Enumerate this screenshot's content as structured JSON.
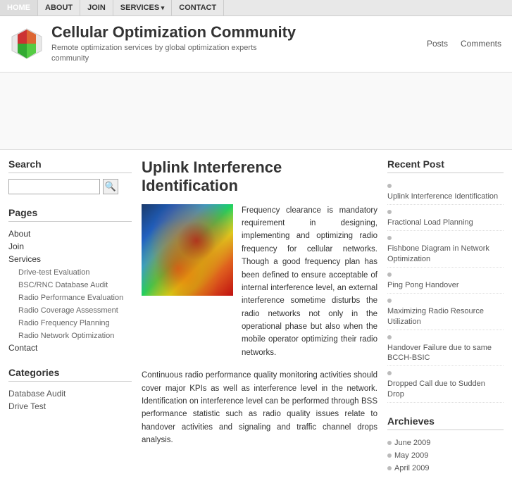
{
  "nav": {
    "items": [
      {
        "label": "HOME",
        "active": true,
        "hasSub": false
      },
      {
        "label": "ABOUT",
        "active": false,
        "hasSub": false
      },
      {
        "label": "JOIN",
        "active": false,
        "hasSub": false
      },
      {
        "label": "SERVICES",
        "active": false,
        "hasSub": true
      },
      {
        "label": "CONTACT",
        "active": false,
        "hasSub": false
      }
    ]
  },
  "header": {
    "site_title": "Cellular Optimization Community",
    "tagline_line1": "Remote optimization services by global optimization experts",
    "tagline_line2": "community",
    "posts_label": "Posts",
    "comments_label": "Comments"
  },
  "sidebar_left": {
    "search_title": "Search",
    "search_placeholder": "",
    "pages_title": "Pages",
    "pages": [
      {
        "label": "About",
        "level": "top"
      },
      {
        "label": "Join",
        "level": "top"
      },
      {
        "label": "Services",
        "level": "top"
      },
      {
        "label": "Drive-test Evaluation",
        "level": "sub"
      },
      {
        "label": "BSC/RNC Database Audit",
        "level": "sub"
      },
      {
        "label": "Radio Performance Evaluation",
        "level": "sub"
      },
      {
        "label": "Radio Coverage Assessment",
        "level": "sub"
      },
      {
        "label": "Radio Frequency Planning",
        "level": "sub"
      },
      {
        "label": "Radio Network Optimization",
        "level": "sub"
      },
      {
        "label": "Contact",
        "level": "top"
      }
    ],
    "categories_title": "Categories",
    "categories": [
      {
        "label": "Database Audit"
      },
      {
        "label": "Drive Test"
      }
    ]
  },
  "content": {
    "post_title": "Uplink Interference Identification",
    "para1": "Frequency clearance is mandatory requirement in designing, implementing and optimizing radio frequency for cellular networks. Though a good frequency plan has been defined to ensure acceptable of internal interference level, an external interference sometime disturbs the radio networks not only in the operational phase but also when the mobile operator optimizing their radio networks.",
    "para2": "Continuous radio performance quality monitoring activities should cover major KPIs as well as interference level in the network. Identification on interference level can be performed through BSS performance statistic such as radio quality issues relate to handover activities and signaling and traffic channel drops analysis."
  },
  "sidebar_right": {
    "recent_title": "Recent Post",
    "recent_posts": [
      {
        "label": "Uplink Interference Identification"
      },
      {
        "label": "Fractional Load Planning"
      },
      {
        "label": "Fishbone Diagram in Network Optimization"
      },
      {
        "label": "Ping Pong Handover"
      },
      {
        "label": "Maximizing Radio Resource Utilization"
      },
      {
        "label": "Handover Failure due to same BCCH-BSIC"
      },
      {
        "label": "Dropped Call due to Sudden Drop"
      }
    ],
    "archives_title": "Archieves",
    "archives": [
      {
        "label": "June 2009"
      },
      {
        "label": "May 2009"
      },
      {
        "label": "April 2009"
      }
    ]
  }
}
